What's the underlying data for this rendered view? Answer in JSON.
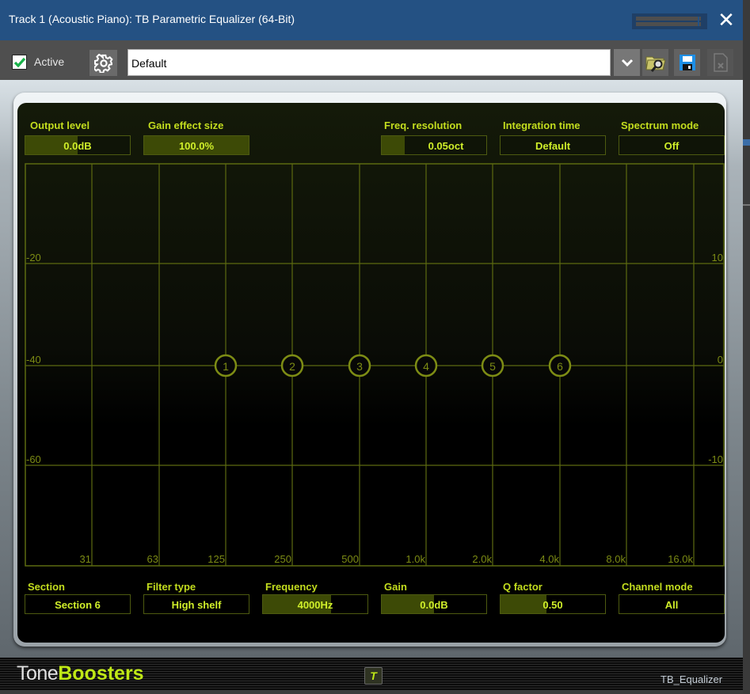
{
  "window": {
    "title": "Track 1 (Acoustic Piano): TB Parametric Equalizer (64-Bit)",
    "close_icon": "close-icon",
    "level_meter": "level-meter"
  },
  "toolbar": {
    "active_label": "Active",
    "active_checked": true,
    "preset_value": "Default",
    "icons": [
      "gear-icon",
      "chevron-down-icon",
      "folder-search-icon",
      "save-icon",
      "delete-file-icon"
    ]
  },
  "top_controls": [
    {
      "label": "Output level",
      "value": "0.0dB",
      "fill": 0.5
    },
    {
      "label": "Gain effect size",
      "value": "100.0%",
      "fill": 1.0
    },
    {
      "label": "Freq. resolution",
      "value": "0.05oct",
      "fill": 0.22
    },
    {
      "label": "Integration time",
      "value": "Default",
      "fill": 0
    },
    {
      "label": "Spectrum mode",
      "value": "Off",
      "fill": 0
    }
  ],
  "graph": {
    "freq_labels": [
      "31",
      "63",
      "125",
      "250",
      "500",
      "1.0k",
      "2.0k",
      "4.0k",
      "8.0k",
      "16.0k"
    ],
    "left_axis_labels": [
      "-20",
      "-40",
      "-60"
    ],
    "right_axis_labels": [
      "10",
      "0",
      "-10"
    ],
    "nodes": [
      "1",
      "2",
      "3",
      "4",
      "5",
      "6"
    ],
    "grid_color": "#5c6a10",
    "text_color": "#7d8c14"
  },
  "bottom_controls": [
    {
      "label": "Section",
      "value": "Section 6",
      "fill": 0
    },
    {
      "label": "Filter type",
      "value": "High shelf",
      "fill": 0
    },
    {
      "label": "Frequency",
      "value": "4000Hz",
      "fill": 0.65
    },
    {
      "label": "Gain",
      "value": "0.0dB",
      "fill": 0.5
    },
    {
      "label": "Q factor",
      "value": "0.50",
      "fill": 0.44
    },
    {
      "label": "Channel mode",
      "value": "All",
      "fill": 0
    }
  ],
  "footer": {
    "brand_tone": "Tone",
    "brand_boosters": "Boosters",
    "t_button": "T",
    "product_name": "TB_Equalizer"
  },
  "colors": {
    "titlebar": "#245183",
    "accent": "#c3dd1e"
  }
}
